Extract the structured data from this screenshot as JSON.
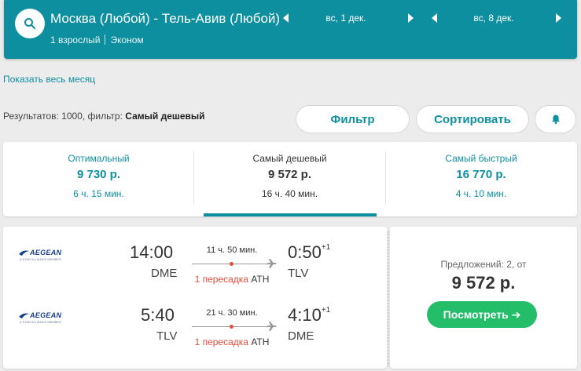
{
  "header": {
    "route": "Москва (Любой) - Тель-Авив (Любой)",
    "passengers": "1 взрослый",
    "cabin": "Эконом",
    "depart_date": "вс, 1 дек.",
    "return_date": "вс, 8 дек.",
    "color": "#0e8fa0"
  },
  "month_link": "Показать весь месяц",
  "results": {
    "prefix": "Результатов: 1000, фильтр: ",
    "filter": "Самый дешевый"
  },
  "buttons": {
    "filter": "Фильтр",
    "sort": "Сортировать",
    "alert_icon": "bell-icon"
  },
  "tabs": [
    {
      "label": "Оптимальный",
      "price": "9 730 р.",
      "duration": "6 ч. 15 мин.",
      "active": false
    },
    {
      "label": "Самый дешевый",
      "price": "9 572 р.",
      "duration": "16 ч. 40 мин.",
      "active": true
    },
    {
      "label": "Самый быстрый",
      "price": "16 770 р.",
      "duration": "4 ч. 10 мин.",
      "active": false
    }
  ],
  "flight": {
    "airline": "AEGEAN",
    "airline_sub": "A STAR ALLIANCE MEMBER",
    "legs": [
      {
        "dep_time": "14:00",
        "dep_airport": "DME",
        "duration": "11 ч. 50 мин.",
        "stops": "1 пересадка",
        "stop_airport": "ATH",
        "arr_time": "0:50",
        "arr_day_offset": "+1",
        "arr_airport": "TLV"
      },
      {
        "dep_time": "5:40",
        "dep_airport": "TLV",
        "duration": "21 ч. 30 мин.",
        "stops": "1 пересадка",
        "stop_airport": "ATH",
        "arr_time": "4:10",
        "arr_day_offset": "+1",
        "arr_airport": "DME"
      }
    ],
    "offers": "Предложений: 2, от",
    "price": "9 572 р.",
    "view_button": "Посмотреть ➔"
  }
}
